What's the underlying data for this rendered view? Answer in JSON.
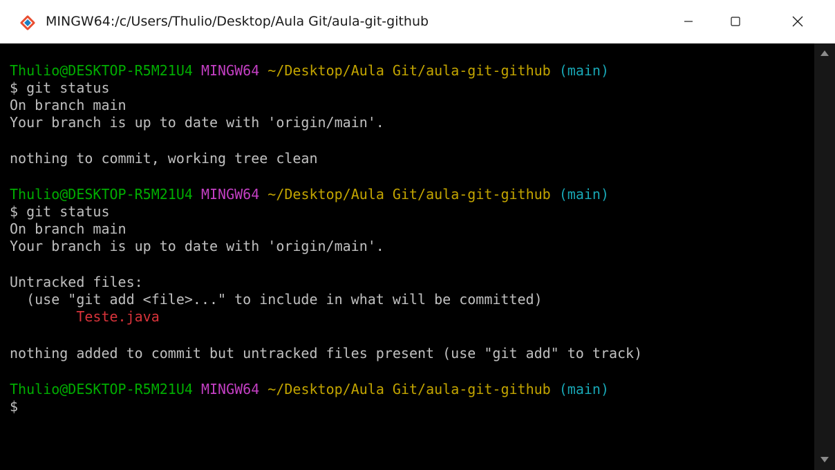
{
  "window": {
    "title": "MINGW64:/c/Users/Thulio/Desktop/Aula Git/aula-git-github",
    "icon": "git-bash-icon"
  },
  "controls": {
    "minimize": "minimize-icon",
    "maximize": "maximize-icon",
    "close": "close-icon"
  },
  "colors": {
    "user": "#00ad00",
    "host": "#c33fc3",
    "path": "#c3a500",
    "branch": "#18a7b5",
    "text": "#c0c0c0",
    "untracked": "#d8333a",
    "background": "#000000"
  },
  "terminal": {
    "prompt_user": "Thulio@DESKTOP-R5M21U4",
    "prompt_host": "MINGW64",
    "prompt_path": "~/Desktop/Aula Git/aula-git-github",
    "prompt_branch": "(main)",
    "cmd1": "$ git status",
    "out1_a": "On branch main",
    "out1_b": "Your branch is up to date with 'origin/main'.",
    "out1_c": "nothing to commit, working tree clean",
    "cmd2": "$ git status",
    "out2_a": "On branch main",
    "out2_b": "Your branch is up to date with 'origin/main'.",
    "out2_c": "Untracked files:",
    "out2_d": "  (use \"git add <file>...\" to include in what will be committed)",
    "out2_file": "        Teste.java",
    "out2_e": "nothing added to commit but untracked files present (use \"git add\" to track)",
    "cmd3": "$"
  }
}
